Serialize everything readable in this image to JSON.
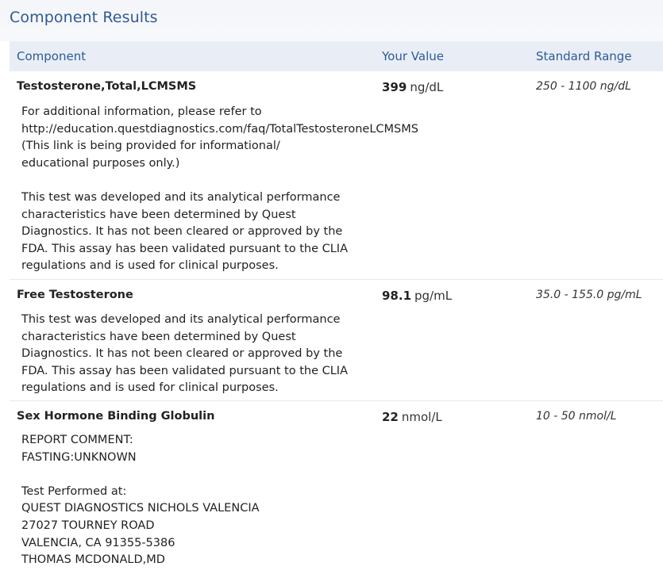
{
  "section": {
    "title": "Component Results"
  },
  "table": {
    "headers": {
      "component": "Component",
      "value": "Your Value",
      "range": "Standard Range"
    },
    "rows": [
      {
        "name": "Testosterone,Total,LCMSMS",
        "value": "399",
        "unit": "ng/dL",
        "range": "250 - 1100 ng/dL",
        "note": "For additional information, please refer to\nhttp://education.questdiagnostics.com/faq/TotalTestosteroneLCMSMS\n(This link is being provided for informational/\neducational purposes only.)\n\nThis test was developed and its analytical performance\ncharacteristics have been determined by Quest\nDiagnostics. It has not been cleared or approved by the\nFDA. This assay has been validated pursuant to the CLIA\nregulations and is used for clinical purposes."
      },
      {
        "name": "Free Testosterone",
        "value": "98.1",
        "unit": "pg/mL",
        "range": "35.0 - 155.0 pg/mL",
        "note": "This test was developed and its analytical performance\ncharacteristics have been determined by Quest\nDiagnostics. It has not been cleared or approved by the\nFDA. This assay has been validated pursuant to the CLIA\nregulations and is used for clinical purposes."
      },
      {
        "name": "Sex Hormone Binding Globulin",
        "value": "22",
        "unit": "nmol/L",
        "range": "10 - 50 nmol/L",
        "note": "REPORT COMMENT:\nFASTING:UNKNOWN\n\nTest Performed at:\nQUEST DIAGNOSTICS NICHOLS VALENCIA\n27027 TOURNEY ROAD\nVALENCIA, CA 91355-5386\nTHOMAS MCDONALD,MD"
      }
    ]
  }
}
